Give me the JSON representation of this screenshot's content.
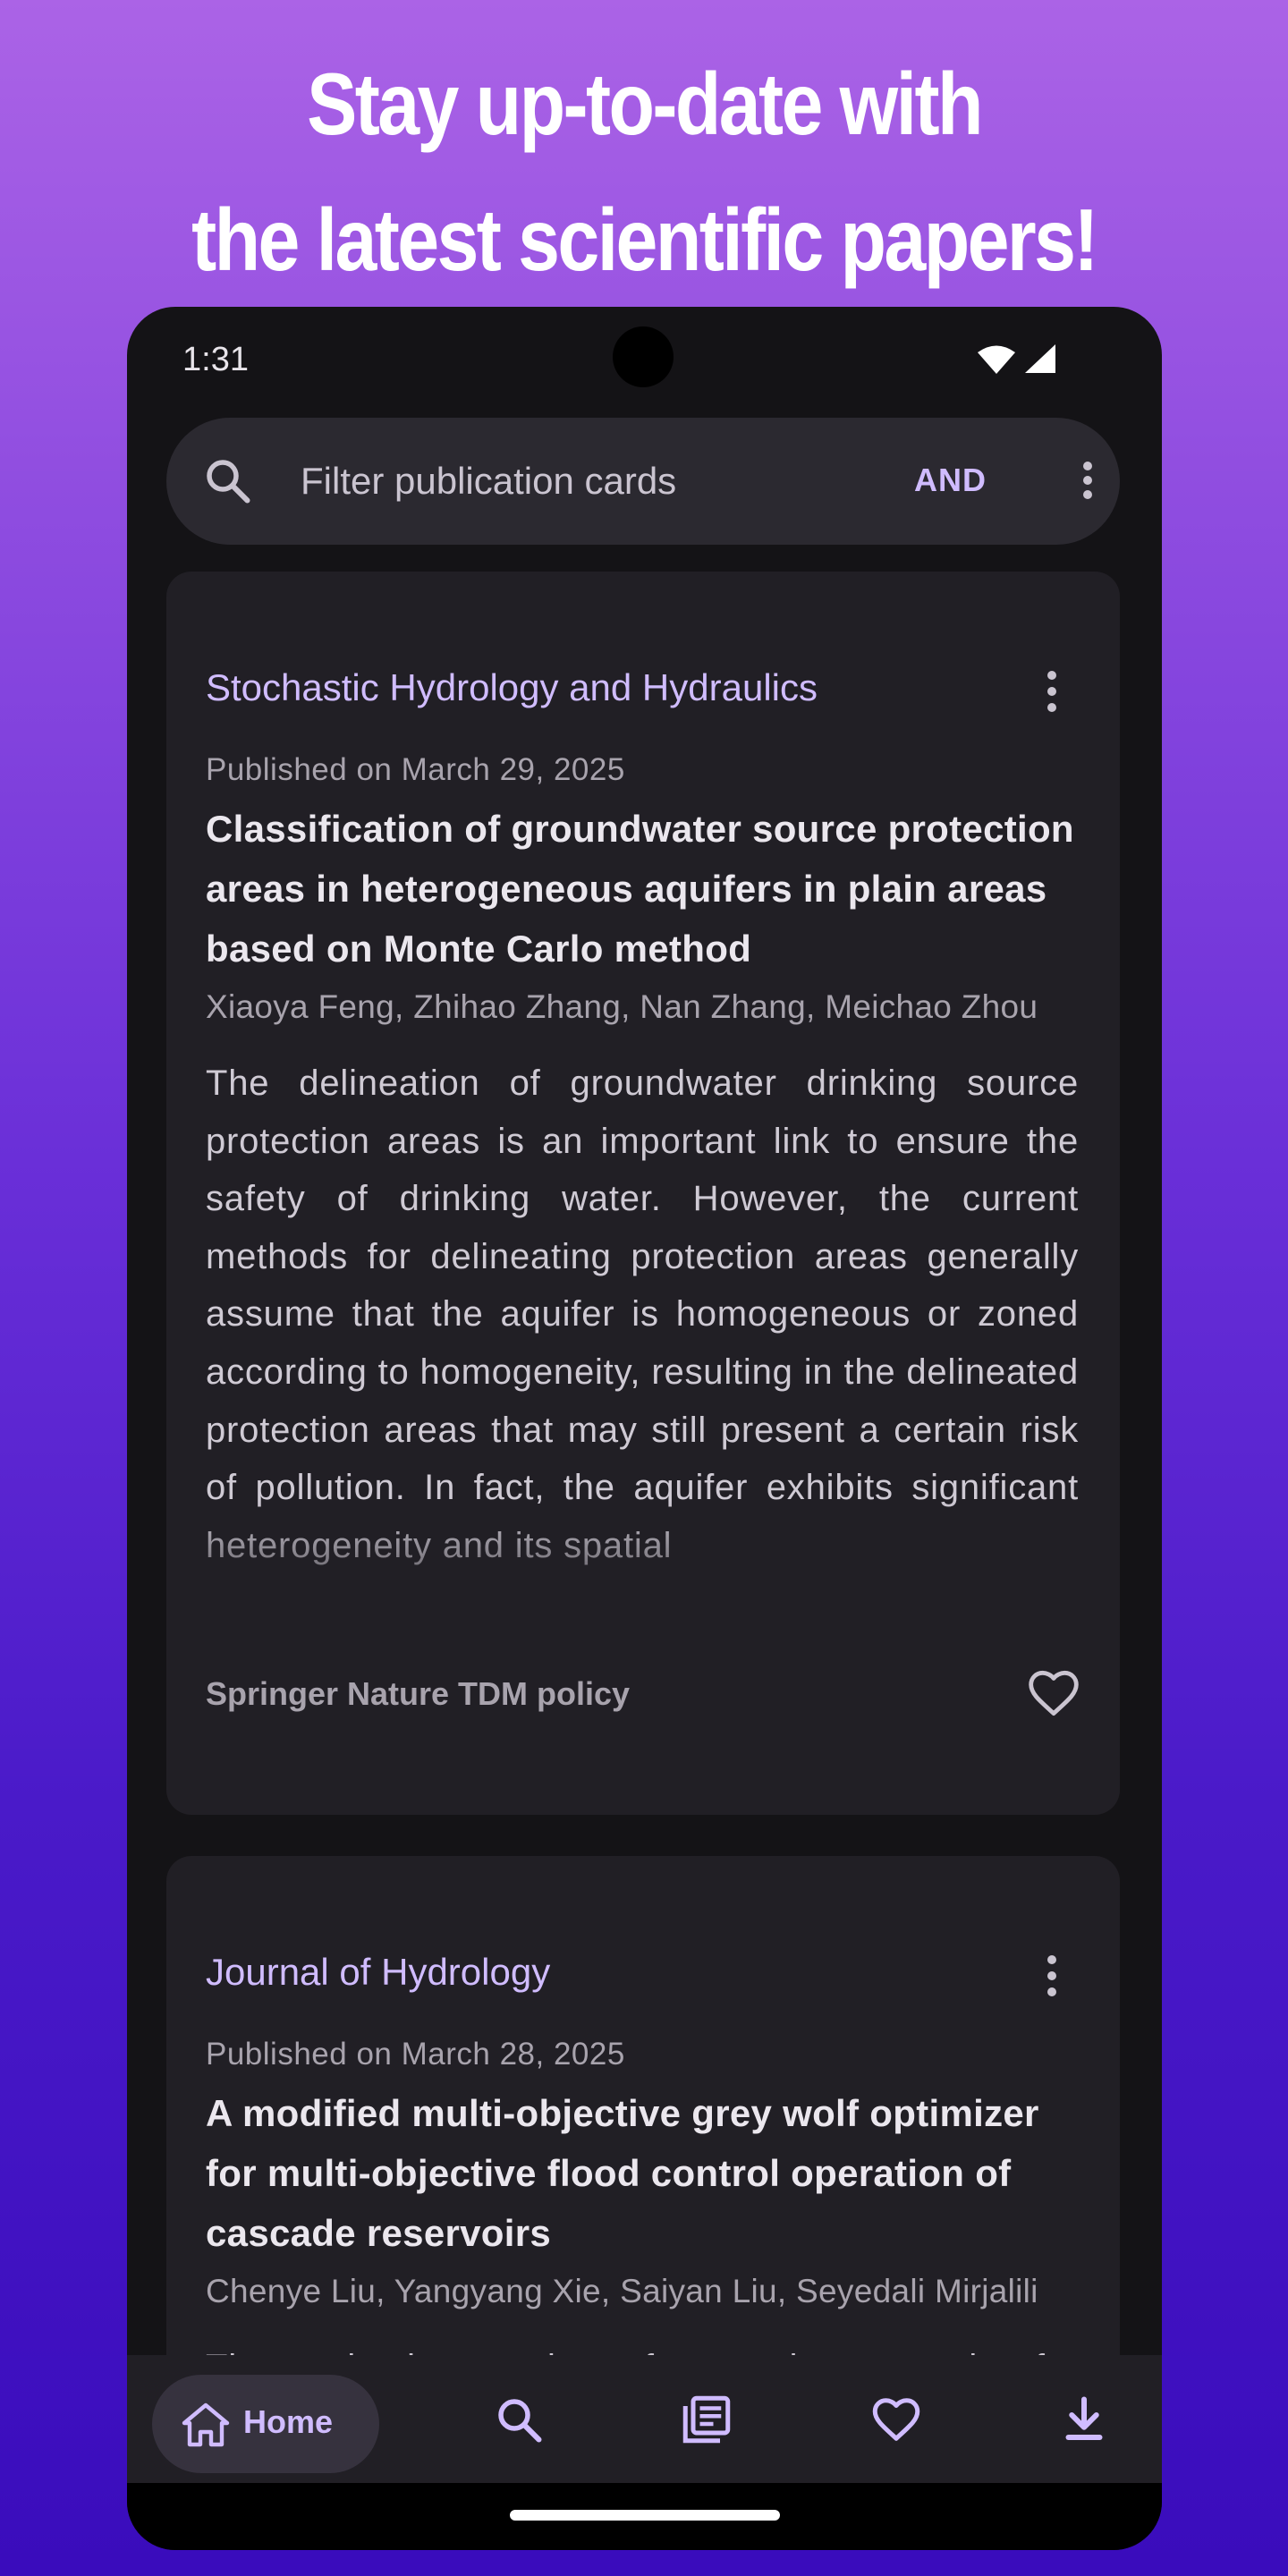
{
  "promo": {
    "headline_line1": "Stay up-to-date with",
    "headline_line2": "the latest scientific papers!"
  },
  "status_bar": {
    "time": "1:31",
    "icons": [
      "wifi-icon",
      "signal-icon"
    ]
  },
  "search": {
    "placeholder": "Filter publication cards",
    "operator_label": "AND",
    "icons": [
      "search-icon",
      "more-vert-icon"
    ]
  },
  "cards": [
    {
      "journal": "Stochastic Hydrology and Hydraulics",
      "published": "Published on March 29, 2025",
      "title": "Classification of groundwater source protection areas in heterogeneous aquifers in plain areas based on Monte Carlo method",
      "authors": "Xiaoya Feng, Zhihao Zhang, Nan Zhang, Meichao Zhou",
      "abstract": "The delineation of groundwater drinking source protection areas is an important link to ensure the safety of drinking water. However, the current methods for delineating protection areas generally assume that the aquifer is homogeneous or zoned according to homogeneity, resulting in the delineated protection areas that may still present a certain risk of pollution. In fact, the aquifer exhibits significant heterogeneity and its spatial",
      "license": "Springer Nature TDM policy",
      "favorite": false
    },
    {
      "journal": "Journal of Hydrology",
      "published": "Published on March 28, 2025",
      "title": "A modified multi-objective grey wolf optimizer for multi-objective flood control operation of cascade reservoirs",
      "authors": "Chenye Liu, Yangyang Xie, Saiyan Liu, Seyedali Mirjalili",
      "abstract": "The optimal operation of cascade reservoirs for flood control and"
    }
  ],
  "bottom_nav": {
    "home_label": "Home",
    "items": [
      "home-icon",
      "search-icon",
      "feed-icon",
      "favorites-icon",
      "download-icon"
    ],
    "active": "Home"
  },
  "colors": {
    "accent": "#d0bcff",
    "card_bg": "#211f25",
    "screen_bg": "#141316",
    "gradient_top": "#ab63e6",
    "gradient_bottom": "#3a0cbc"
  }
}
